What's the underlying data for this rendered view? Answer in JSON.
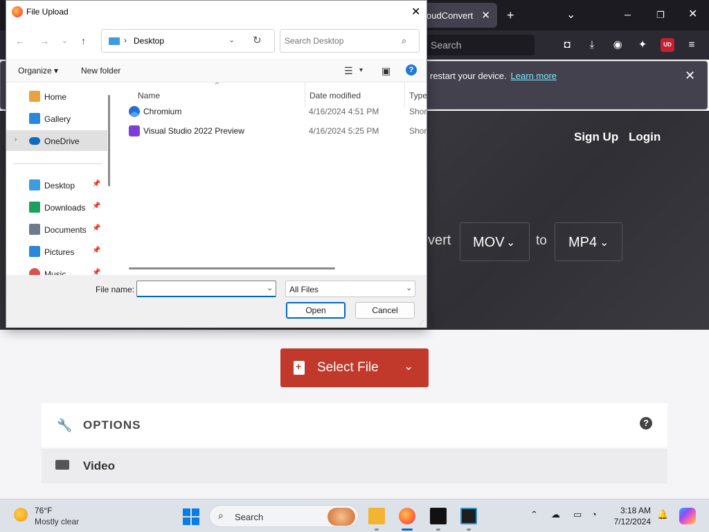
{
  "browser": {
    "tab_title": "oudConvert",
    "search_placeholder": "Search",
    "notification": {
      "message": "restart your device.",
      "link": "Learn more"
    },
    "header_links": {
      "signup": "Sign Up",
      "login": "Login"
    },
    "hero": {
      "convert_label": "vert",
      "from_format": "MOV",
      "to_label": "to",
      "to_format": "MP4"
    },
    "select_file_label": "Select File",
    "options_label": "OPTIONS",
    "video_label": "Video",
    "ext_badge": "UD"
  },
  "dialog": {
    "title": "File Upload",
    "path": "Desktop",
    "search_placeholder": "Search Desktop",
    "organize_label": "Organize",
    "new_folder_label": "New folder",
    "nav_items": [
      {
        "label": "Home",
        "icon": "home-icon"
      },
      {
        "label": "Gallery",
        "icon": "gallery-icon"
      },
      {
        "label": "OneDrive",
        "icon": "onedrive-icon"
      },
      {
        "label": "Desktop",
        "icon": "desktop-icon"
      },
      {
        "label": "Downloads",
        "icon": "downloads-icon"
      },
      {
        "label": "Documents",
        "icon": "documents-icon"
      },
      {
        "label": "Pictures",
        "icon": "pictures-icon"
      },
      {
        "label": "Music",
        "icon": "music-icon"
      }
    ],
    "columns": {
      "name": "Name",
      "date_modified": "Date modified",
      "type": "Type"
    },
    "files": [
      {
        "name": "Chromium",
        "date": "4/16/2024 4:51 PM",
        "type": "Short"
      },
      {
        "name": "Visual Studio 2022 Preview",
        "date": "4/16/2024 5:25 PM",
        "type": "Short"
      }
    ],
    "file_name_label": "File name:",
    "file_name_value": "",
    "file_type_value": "All Files",
    "open_label": "Open",
    "cancel_label": "Cancel"
  },
  "taskbar": {
    "weather_temp": "76°F",
    "weather_desc": "Mostly clear",
    "search_placeholder": "Search",
    "time": "3:18 AM",
    "date": "7/12/2024"
  },
  "colors": {
    "accent_red": "#c1392b",
    "windows_blue": "#0067c0",
    "firefox_dark": "#1c1b22"
  }
}
